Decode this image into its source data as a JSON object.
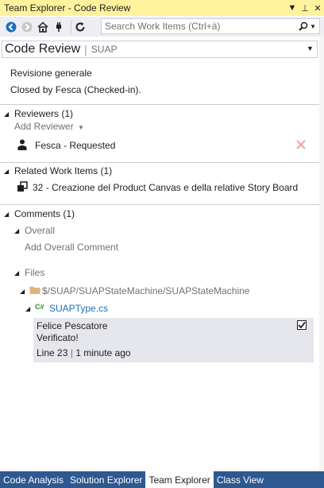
{
  "window": {
    "title": "Team Explorer - Code Review"
  },
  "title_buttons": {
    "dropdown": "▼",
    "pin": "⊥",
    "close": "✕"
  },
  "search": {
    "placeholder": "Search Work Items (Ctrl+à)",
    "icon": "search-icon"
  },
  "header": {
    "title": "Code Review",
    "project": "SUAP"
  },
  "review": {
    "name": "Revisione generale",
    "status": "Closed by Fesca (Checked-in)."
  },
  "reviewers": {
    "heading": "Reviewers (1)",
    "add_label": "Add Reviewer",
    "items": [
      {
        "name": "Fesca - Requested"
      }
    ]
  },
  "work_items": {
    "heading": "Related Work Items (1)",
    "items": [
      {
        "label": "32 - Creazione del Product Canvas e della relative Story Board"
      }
    ]
  },
  "comments": {
    "heading": "Comments (1)",
    "overall": {
      "heading": "Overall",
      "add_label": "Add Overall Comment"
    },
    "files": {
      "heading": "Files",
      "folder": "$/SUAP/SUAPStateMachine/SUAPStateMachine",
      "file_lang": "C#",
      "file": "SUAPType.cs",
      "comment": {
        "author": "Felice Pescatore",
        "text": "Verificato!",
        "line": "Line 23",
        "time": "1 minute ago",
        "checked": true
      }
    }
  },
  "bottom_tabs": [
    {
      "label": "Code Analysis",
      "active": false
    },
    {
      "label": "Solution Explorer",
      "active": false
    },
    {
      "label": "Team Explorer",
      "active": true
    },
    {
      "label": "Class View",
      "active": false
    }
  ],
  "colors": {
    "title_bg": "#fff29d",
    "tab_bar": "#2d5890",
    "toolbar": "#eeeef2",
    "link_blue": "#1e6fbe",
    "comment_bg": "#e6e7ed"
  }
}
